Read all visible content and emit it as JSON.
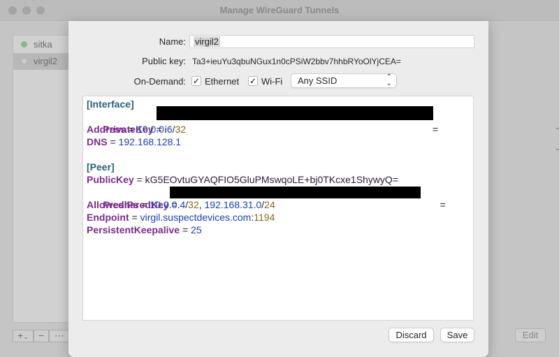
{
  "window": {
    "title": "Manage WireGuard Tunnels",
    "tunnels": [
      {
        "name": "sitka",
        "status_color": "#7fbf7f"
      },
      {
        "name": "virgil2",
        "status_color": "#d8d8d8"
      }
    ],
    "bottom_buttons": [
      "+",
      "−",
      "⋯"
    ],
    "edit_label": "Edit"
  },
  "sheet": {
    "name_label": "Name:",
    "name_value": "virgil2",
    "pubkey_label": "Public key:",
    "pubkey_value": "Ta3+ieuYu3qbuNGux1n0cPSiW2bbv7hhbRYoOlYjCEA=",
    "on_demand_label": "On-Demand:",
    "ethernet_label": "Ethernet",
    "ethernet_checked": true,
    "wifi_label": "Wi-Fi",
    "wifi_checked": true,
    "ssid_value": "Any SSID",
    "config": {
      "interface_header": "[Interface]",
      "private_key_key": "PrivateKey",
      "private_key_value_visible": "i",
      "private_key_value_tail": "=",
      "address_key": "Address",
      "address_ip": "10.0.0.6",
      "address_cidr": "32",
      "dns_key": "DNS",
      "dns_value": "192.168.128.1",
      "peer_header": "[Peer]",
      "public_key_key": "PublicKey",
      "public_key_value": "kG5EOvtuGYAQFIO5GluPMswqoLE+bj0TKcxe1ShywyQ=",
      "psk_key": "PresharedKey",
      "psk_value_tail": "=",
      "allowed_key": "AllowedIPs",
      "allowed_ip1": "10.0.0.4",
      "allowed_cidr1": "32",
      "allowed_ip2": "192.168.31.0",
      "allowed_cidr2": "24",
      "endpoint_key": "Endpoint",
      "endpoint_host": "virgil.suspectdevices.com",
      "endpoint_port": "1194",
      "keepalive_key": "PersistentKeepalive",
      "keepalive_value": "25"
    },
    "discard_label": "Discard",
    "save_label": "Save"
  }
}
